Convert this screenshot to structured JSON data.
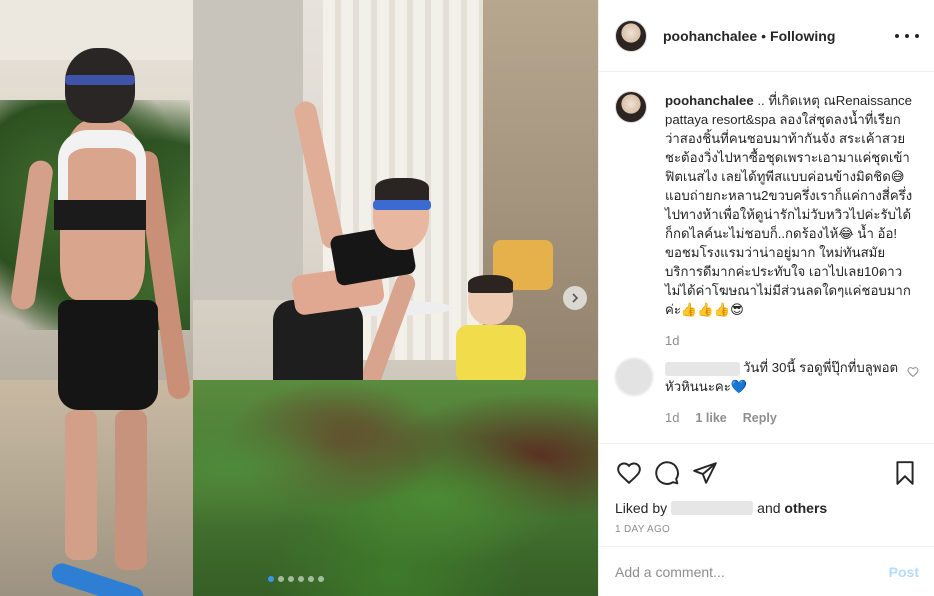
{
  "header": {
    "username": "poohanchalee",
    "separator": "•",
    "follow_status": "Following"
  },
  "caption": {
    "username": "poohanchalee",
    "text": " .. ที่เกิดเหตุ ณRenaissance pattaya resort&spa ลองใส่ชุดลงน้ำที่เรียกว่าสองชิ้นที่คนชอบมาท้ากันจัง สระเค้าสวยชะต้องวิ่งไปหาซื้อชุดเพราะเอามาแค่ชุดเข้าฟิตเนสไง เลยได้ทูพีสแบบค่อนข้างมิดชิด😅 แอบถ่ายกะหลาน2ขวบครึ่งเราก็แค่กางสี่ครึ่งไปทางห้าเพื่อให้ดูน่ารักไม่วับหวิวไปค่ะรับได้ก็กดไลค์นะไม่ชอบก็..กดร้องไห้😂 น้ำ อ้อ! ขอชมโรงแรมว่าน่าอยู่มาก ใหม่ทันสมัย บริการดีมากค่ะประทับใจ เอาไปเลย10ดาว ไม่ได้ค่าโฆษณาไม่มีส่วนลดใดๆแค่ชอบมากค่ะ👍👍👍😎",
    "age": "1d"
  },
  "comment": {
    "text": "วันที่ 30นี้ รอดูพี่ปุ๊กที่บลูพอตหัวหินนะคะ💙",
    "age": "1d",
    "likes": "1 like",
    "reply": "Reply"
  },
  "actions": {
    "liked_prefix": "Liked by",
    "liked_suffix": "and",
    "liked_others": "others",
    "time_ago": "1 DAY AGO"
  },
  "add_comment": {
    "placeholder": "Add a comment...",
    "post_label": "Post"
  },
  "carousel": {
    "total": 6,
    "active": 1
  },
  "colors": {
    "accent": "#3897f0",
    "post_disabled": "#b3dbff",
    "text": "#262626",
    "muted": "#8e8e8e"
  }
}
